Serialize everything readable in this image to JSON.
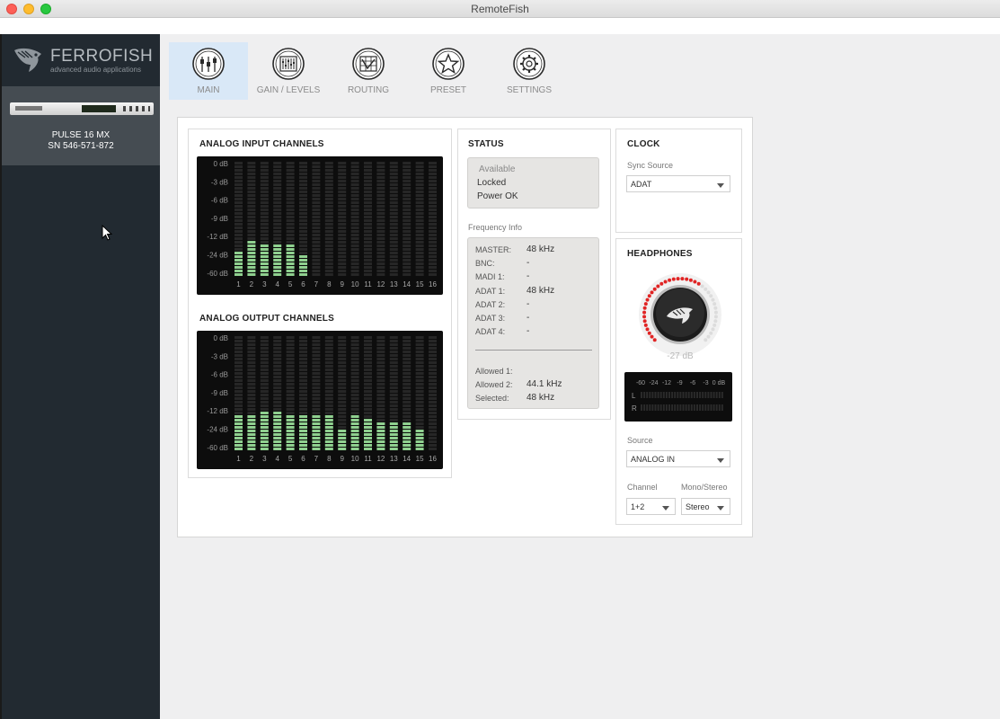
{
  "window": {
    "title": "RemoteFish"
  },
  "brand": {
    "name": "FERROFISH",
    "tagline": "advanced audio applications"
  },
  "device": {
    "model": "PULSE 16 MX",
    "serial": "SN 546-571-872"
  },
  "toolbar": {
    "items": [
      {
        "label": "MAIN",
        "icon": "sliders-icon",
        "active": true
      },
      {
        "label": "GAIN / LEVELS",
        "icon": "mixer-icon",
        "active": false
      },
      {
        "label": "ROUTING",
        "icon": "routing-icon",
        "active": false
      },
      {
        "label": "PRESET",
        "icon": "star-icon",
        "active": false
      },
      {
        "label": "SETTINGS",
        "icon": "gear-icon",
        "active": false
      }
    ]
  },
  "analog_input": {
    "title": "ANALOG INPUT CHANNELS",
    "db_labels": [
      "0 dB",
      "-3 dB",
      "-6 dB",
      "-9 dB",
      "-12 dB",
      "-24 dB",
      "-60 dB"
    ],
    "channels": [
      "1",
      "2",
      "3",
      "4",
      "5",
      "6",
      "7",
      "8",
      "9",
      "10",
      "11",
      "12",
      "13",
      "14",
      "15",
      "16"
    ],
    "levels": [
      0.22,
      0.31,
      0.27,
      0.27,
      0.27,
      0.2,
      0,
      0,
      0,
      0,
      0,
      0,
      0,
      0,
      0,
      0
    ]
  },
  "analog_output": {
    "title": "ANALOG OUTPUT CHANNELS",
    "db_labels": [
      "0 dB",
      "-3 dB",
      "-6 dB",
      "-9 dB",
      "-12 dB",
      "-24 dB",
      "-60 dB"
    ],
    "channels": [
      "1",
      "2",
      "3",
      "4",
      "5",
      "6",
      "7",
      "8",
      "9",
      "10",
      "11",
      "12",
      "13",
      "14",
      "15",
      "16"
    ],
    "levels": [
      0.3,
      0.32,
      0.34,
      0.33,
      0.31,
      0.31,
      0.31,
      0.31,
      0.2,
      0.31,
      0.28,
      0.26,
      0.26,
      0.26,
      0.18,
      0
    ]
  },
  "status": {
    "title": "STATUS",
    "available": "Available",
    "locked": "Locked",
    "power": "Power OK",
    "freq_title": "Frequency Info",
    "freq_rows": [
      {
        "label": "MASTER:",
        "value": "48 kHz"
      },
      {
        "label": "BNC:",
        "value": "-"
      },
      {
        "label": "MADI 1:",
        "value": "-"
      },
      {
        "label": "ADAT 1:",
        "value": "48 kHz"
      },
      {
        "label": "ADAT 2:",
        "value": "-"
      },
      {
        "label": "ADAT 3:",
        "value": "-"
      },
      {
        "label": "ADAT 4:",
        "value": "-"
      }
    ],
    "allowed_rows": [
      {
        "label": "Allowed 1:",
        "value": ""
      },
      {
        "label": "Allowed 2:",
        "value": "44.1 kHz"
      },
      {
        "label": "Selected:",
        "value": "48 kHz"
      }
    ]
  },
  "clock": {
    "title": "CLOCK",
    "sync_label": "Sync Source",
    "sync_value": "ADAT"
  },
  "headphones": {
    "title": "HEADPHONES",
    "volume": "-27 dB",
    "meter_scale": [
      "-60",
      "-24",
      "-12",
      "-9",
      "-6",
      "-3",
      "0 dB"
    ],
    "meter_l": "L",
    "meter_r": "R",
    "source_label": "Source",
    "source_value": "ANALOG IN",
    "channel_label": "Channel",
    "channel_value": "1+2",
    "mono_label": "Mono/Stereo",
    "mono_value": "Stereo"
  },
  "colors": {
    "sidebar": "#222a31",
    "active_tab": "#d9e8f7",
    "meter_green": "#8fd08f",
    "knob_red": "#e02424"
  }
}
